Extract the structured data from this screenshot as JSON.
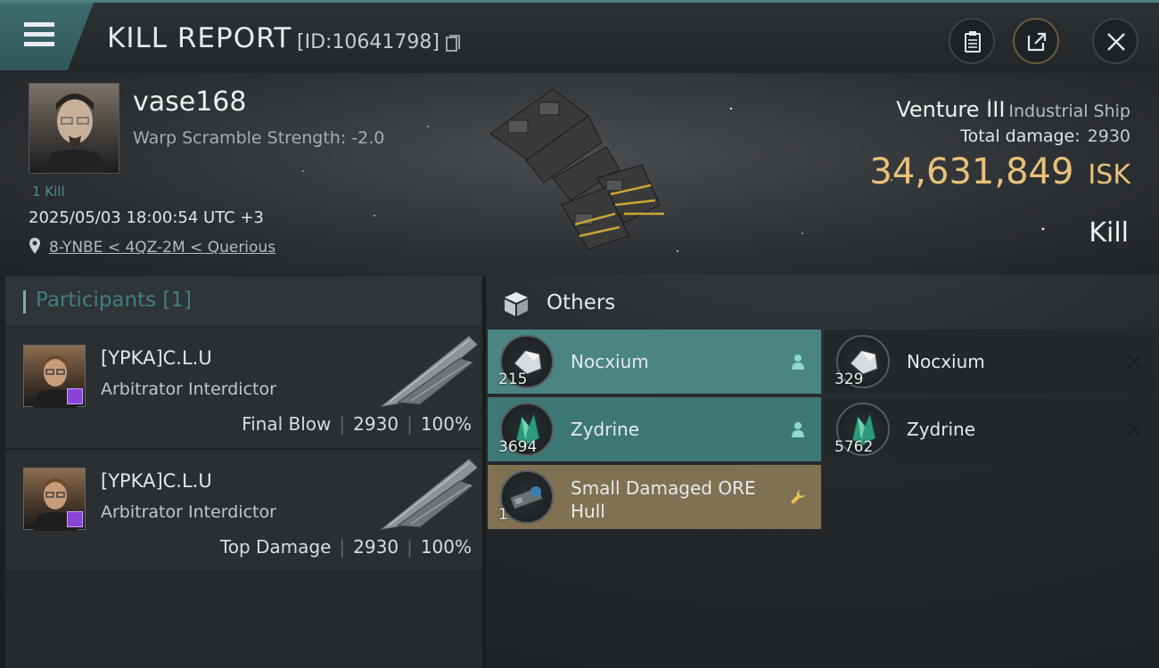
{
  "header": {
    "title": "KILL REPORT",
    "report_id": "[ID:10641798]",
    "menu_icon": "hamburger-icon",
    "buttons": [
      "clipboard-icon",
      "share-icon",
      "close-icon"
    ]
  },
  "victim": {
    "name": "vase168",
    "warp_scramble": "Warp Scramble Strength: -2.0",
    "kills": "1 Kill",
    "timestamp": "2025/05/03 18:00:54 UTC +3",
    "location": "8-YNBE < 4QZ-2M < Querious",
    "ship_name": "Venture III",
    "ship_class": "Industrial Ship",
    "total_damage_label": "Total damage:",
    "total_damage": "2930",
    "isk_value": "34,631,849",
    "isk_unit": "ISK",
    "result": "Kill"
  },
  "participants": {
    "label": "Participants [1]",
    "rows": [
      {
        "name": "[YPKA]C.L.U",
        "ship": "Arbitrator Interdictor",
        "role": "Final Blow",
        "damage": "2930",
        "percent": "100%"
      },
      {
        "name": "[YPKA]C.L.U",
        "ship": "Arbitrator Interdictor",
        "role": "Top Damage",
        "damage": "2930",
        "percent": "100%"
      }
    ]
  },
  "others": {
    "label": "Others",
    "items": [
      {
        "name": "Nocxium",
        "qty": "215",
        "state": "dropped",
        "icon": "person-icon"
      },
      {
        "name": "Nocxium",
        "qty": "329",
        "state": "destroyed",
        "icon": "x-icon"
      },
      {
        "name": "Zydrine",
        "qty": "3694",
        "state": "dropped",
        "icon": "person-icon"
      },
      {
        "name": "Zydrine",
        "qty": "5762",
        "state": "destroyed",
        "icon": "x-icon"
      },
      {
        "name": "Small Damaged ORE Hull",
        "qty": "1",
        "state": "fitted",
        "icon": "wrench-icon"
      }
    ]
  },
  "colors": {
    "accent_teal": "#4a8583",
    "isk_gold": "#e8c27a",
    "fitted_gold": "#7f7152",
    "participant_badge": "#8a43d6"
  }
}
